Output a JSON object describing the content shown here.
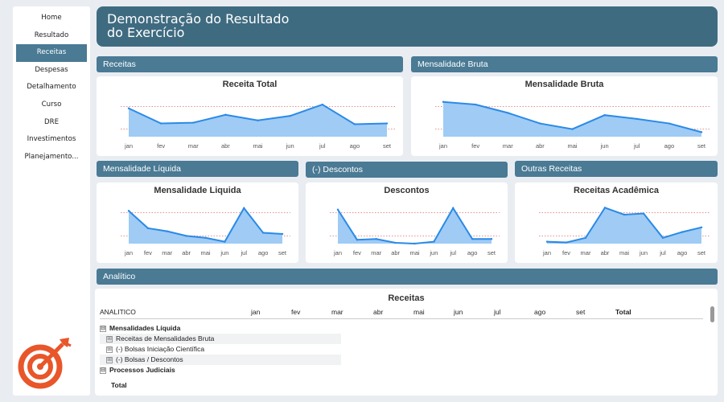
{
  "header": {
    "title_line1": "Demonstração do Resultado",
    "title_line2": "do Exercício"
  },
  "sidebar": {
    "items": [
      {
        "label": "Home"
      },
      {
        "label": "Resultado"
      },
      {
        "label": "Receitas",
        "active": true
      },
      {
        "label": "Despesas"
      },
      {
        "label": "Detalhamento"
      },
      {
        "label": "Curso"
      },
      {
        "label": "DRE"
      },
      {
        "label": "Investimentos"
      },
      {
        "label": "Planejamento..."
      }
    ],
    "logo_icon": "target-arrow-icon"
  },
  "sections": {
    "receitas": "Receitas",
    "mensalidade_bruta": "Mensalidade Bruta",
    "mensalidade_liquida": "Mensalidade Líquida",
    "descontos": "(-) Descontos",
    "outras_receitas": "Outras Receitas",
    "analitico": "Analítico"
  },
  "months": [
    "jan",
    "fev",
    "mar",
    "abr",
    "mai",
    "jun",
    "jul",
    "ago",
    "set"
  ],
  "chart_data": [
    {
      "type": "area",
      "title": "Receita Total",
      "categories": [
        "jan",
        "fev",
        "mar",
        "abr",
        "mai",
        "jun",
        "jul",
        "ago",
        "set"
      ],
      "values": [
        0.75,
        0.35,
        0.37,
        0.58,
        0.43,
        0.55,
        0.85,
        0.33,
        0.35
      ],
      "note": "values obscured; relative shape only"
    },
    {
      "type": "area",
      "title": "Mensalidade Bruta",
      "categories": [
        "jan",
        "fev",
        "mar",
        "abr",
        "mai",
        "jun",
        "jul",
        "ago",
        "set"
      ],
      "values": [
        0.92,
        0.85,
        0.63,
        0.35,
        0.2,
        0.57,
        0.47,
        0.35,
        0.12
      ],
      "note": "values obscured; relative shape only"
    },
    {
      "type": "area",
      "title": "Mensalidade Liquida",
      "categories": [
        "jan",
        "fev",
        "mar",
        "abr",
        "mai",
        "jun",
        "jul",
        "ago",
        "set"
      ],
      "values": [
        0.85,
        0.4,
        0.32,
        0.2,
        0.15,
        0.05,
        0.92,
        0.28,
        0.25
      ],
      "note": "values obscured; relative shape only"
    },
    {
      "type": "area",
      "title": "Descontos",
      "categories": [
        "jan",
        "fev",
        "mar",
        "abr",
        "mai",
        "jun",
        "jul",
        "ago",
        "set"
      ],
      "values": [
        0.88,
        0.1,
        0.12,
        0.02,
        0.0,
        0.05,
        0.92,
        0.12,
        0.12
      ],
      "note": "values obscured; relative shape only"
    },
    {
      "type": "area",
      "title": "Receitas Acadêmica",
      "categories": [
        "jan",
        "fev",
        "mar",
        "abr",
        "mai",
        "jun",
        "jul",
        "ago",
        "set"
      ],
      "values": [
        0.05,
        0.03,
        0.15,
        0.93,
        0.75,
        0.78,
        0.15,
        0.3,
        0.42
      ],
      "note": "values obscured; relative shape only"
    }
  ],
  "colors": {
    "accent": "#4a7a94",
    "header": "#3f6b80",
    "line": "#2a8ae6",
    "area": "#9fcbf5",
    "refline": "#e06b6b"
  },
  "table": {
    "title": "Receitas",
    "columns": [
      "ANALITICO",
      "jan",
      "fev",
      "mar",
      "abr",
      "mai",
      "jun",
      "jul",
      "ago",
      "set",
      "Total"
    ],
    "rows": [
      {
        "label": "Mensalidades Líquida",
        "level": 0,
        "expander": "⊟"
      },
      {
        "label": "Receitas de Mensalidades Bruta",
        "level": 1,
        "expander": "⊞"
      },
      {
        "label": "(-) Bolsas Iniciação Científica",
        "level": 1,
        "expander": "⊞"
      },
      {
        "label": "(-) Bolsas / Descontos",
        "level": 1,
        "expander": "⊞"
      },
      {
        "label": "Processos Judiciais",
        "level": 0,
        "expander": "⊟"
      },
      {
        "label": "Total",
        "level": 0,
        "expander": ""
      }
    ]
  }
}
